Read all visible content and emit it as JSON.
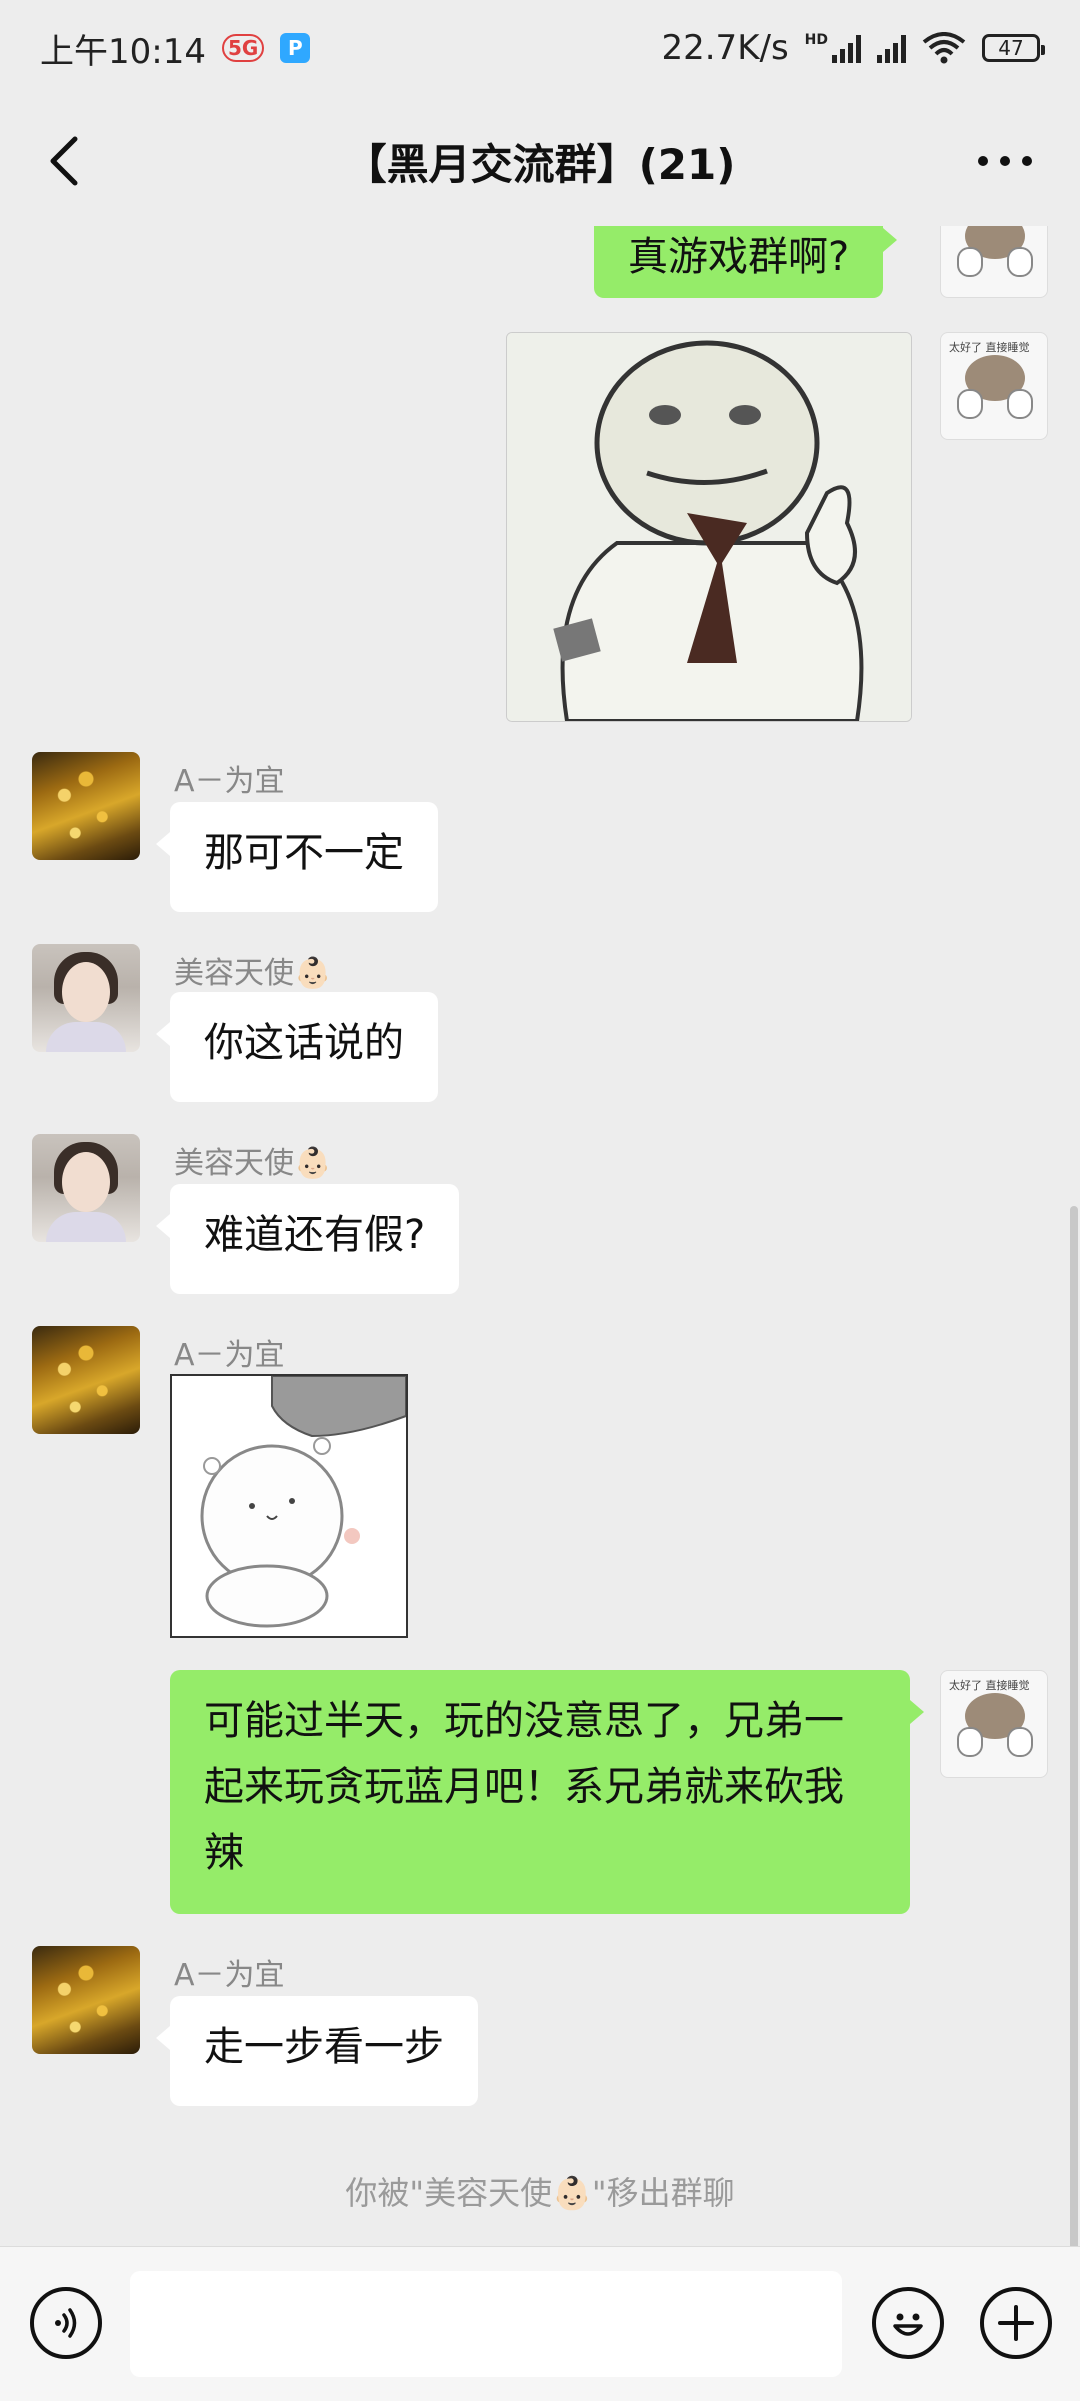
{
  "status_bar": {
    "time": "上午10:14",
    "network_badge": "5G",
    "app_badge": "P",
    "net_speed": "22.7K/s",
    "hd_label": "HD",
    "battery": "47",
    "icons": [
      "5g-icon",
      "app-notification-icon",
      "signal-icon",
      "wifi-icon",
      "battery-icon"
    ]
  },
  "header": {
    "title": "【黑月交流群】(21)",
    "back_icon": "back-arrow-icon",
    "more_icon": "more-dots-icon"
  },
  "messages": [
    {
      "sender": "",
      "direction": "out",
      "type": "text",
      "text": "真游戏群啊?"
    },
    {
      "sender": "",
      "direction": "out",
      "type": "sticker",
      "sticker": "meme-face-sticker"
    },
    {
      "sender": "A－为宜",
      "direction": "in",
      "type": "text",
      "text": "那可不一定"
    },
    {
      "sender": "美容天使👶🏻",
      "direction": "in",
      "type": "text",
      "text": "你这话说的"
    },
    {
      "sender": "美容天使👶🏻",
      "direction": "in",
      "type": "text",
      "text": "难道还有假?"
    },
    {
      "sender": "A－为宜",
      "direction": "in",
      "type": "sticker",
      "sticker": "hamster-sticker"
    },
    {
      "sender": "",
      "direction": "out",
      "type": "text",
      "text": "可能过半天，玩的没意思了，兄弟一起来玩贪玩蓝月吧！系兄弟就来砍我辣"
    },
    {
      "sender": "A－为宜",
      "direction": "in",
      "type": "text",
      "text": "走一步看一步"
    }
  ],
  "system_message": "你被\"美容天使👶🏻\"移出群聊",
  "self_avatar_text": "太好了 直接睡觉",
  "input_bar": {
    "voice_icon": "voice-icon",
    "emoji_icon": "emoji-icon",
    "plus_icon": "plus-icon"
  },
  "colors": {
    "background": "#ededed",
    "outgoing_bubble": "#95ec69",
    "incoming_bubble": "#ffffff",
    "sender_name": "#888888",
    "system_text": "#9a9a9a"
  }
}
